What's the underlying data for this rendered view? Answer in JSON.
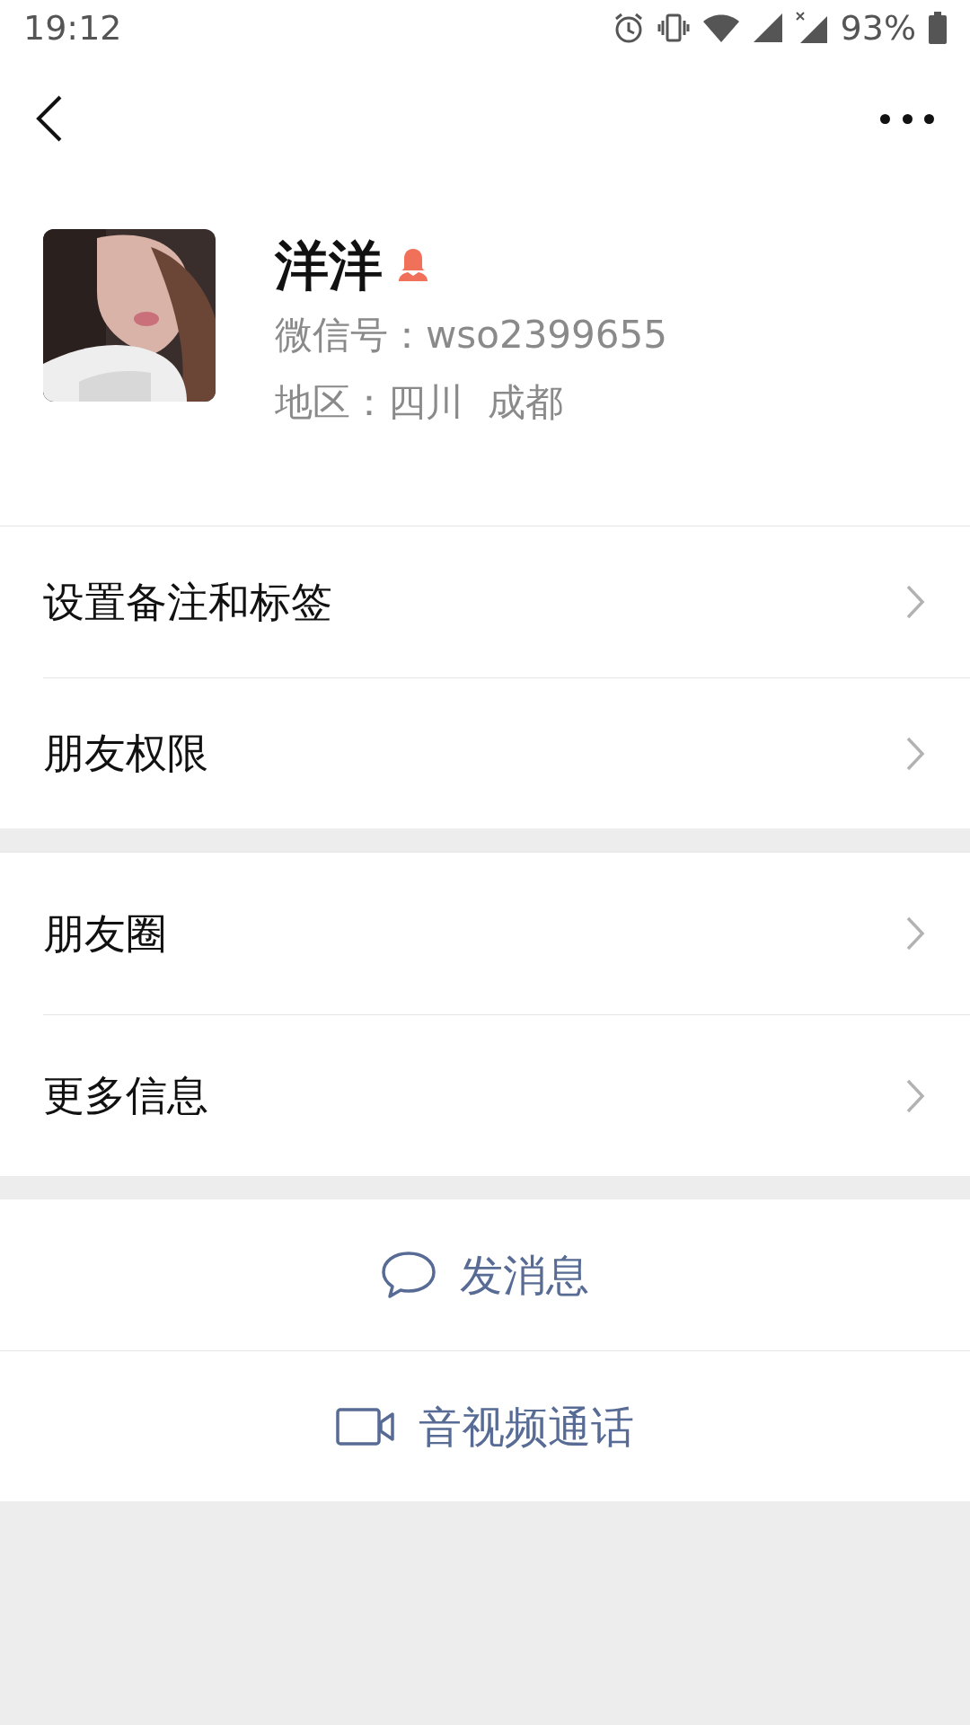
{
  "status_bar": {
    "time": "19:12",
    "battery": "93%"
  },
  "profile": {
    "name": "洋洋",
    "gender_icon": {
      "kind": "female"
    },
    "wechat_id": "微信号：wso2399655",
    "region": "地区：四川  成都"
  },
  "menu_groups": [
    [
      {
        "label": "设置备注和标签"
      },
      {
        "label": "朋友权限"
      }
    ],
    [
      {
        "label": "朋友圈"
      },
      {
        "label": "更多信息"
      }
    ]
  ],
  "actions": [
    {
      "kind": "message",
      "label": "发消息"
    },
    {
      "kind": "video",
      "label": "音视频通话"
    }
  ]
}
